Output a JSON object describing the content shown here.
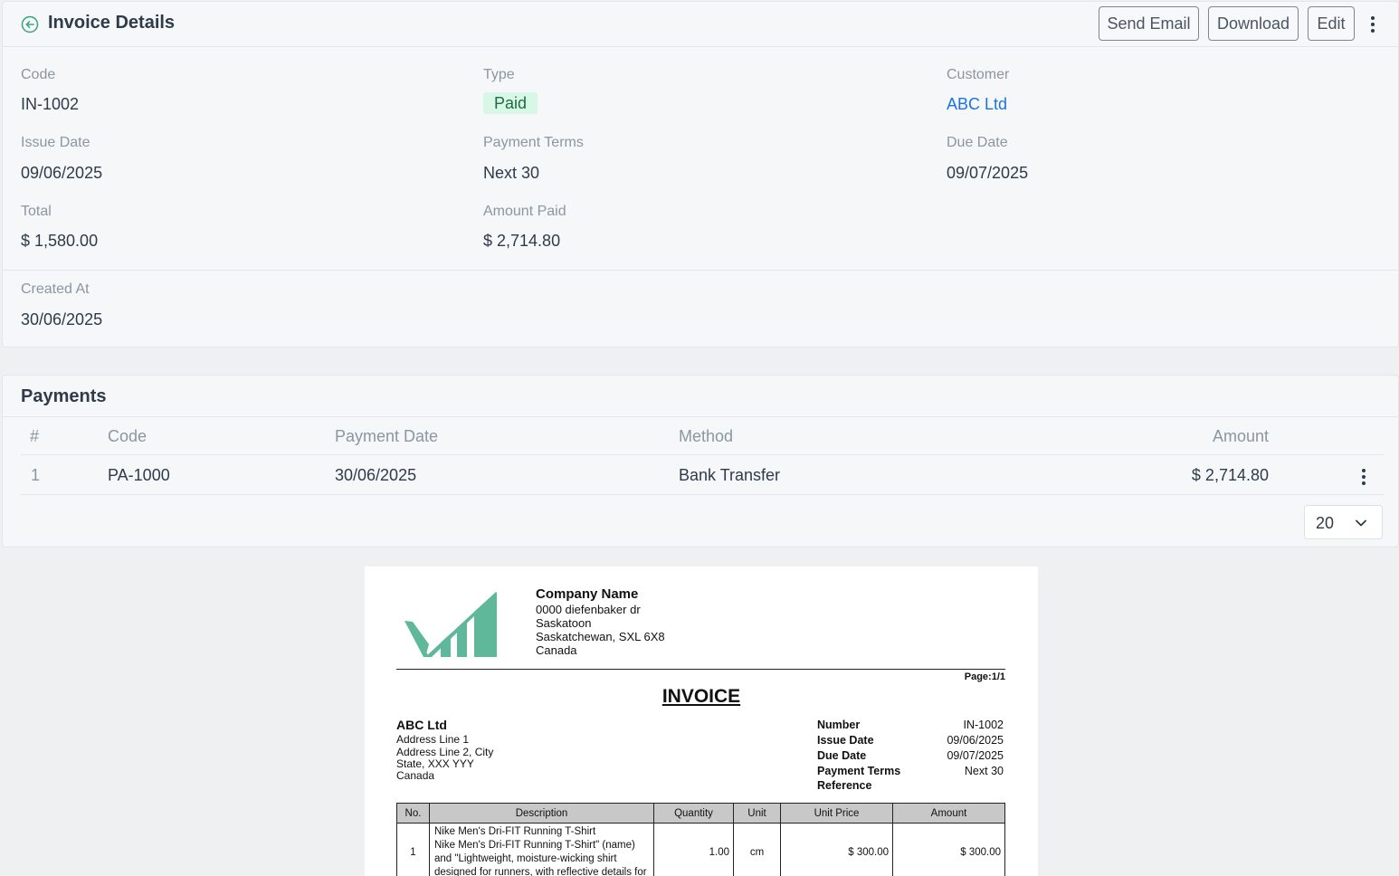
{
  "header": {
    "title": "Invoice Details",
    "buttons": {
      "send_email": "Send Email",
      "download": "Download",
      "edit": "Edit"
    }
  },
  "details": {
    "code_label": "Code",
    "code": "IN-1002",
    "type_label": "Type",
    "type": "Paid",
    "customer_label": "Customer",
    "customer": "ABC Ltd",
    "issue_date_label": "Issue Date",
    "issue_date": "09/06/2025",
    "payment_terms_label": "Payment Terms",
    "payment_terms": "Next 30",
    "due_date_label": "Due Date",
    "due_date": "09/07/2025",
    "total_label": "Total",
    "total": "$ 1,580.00",
    "amount_paid_label": "Amount Paid",
    "amount_paid": "$ 2,714.80",
    "created_at_label": "Created At",
    "created_at": "30/06/2025"
  },
  "payments": {
    "title": "Payments",
    "columns": {
      "index": "#",
      "code": "Code",
      "payment_date": "Payment Date",
      "method": "Method",
      "amount": "Amount"
    },
    "rows": [
      {
        "index": "1",
        "code": "PA-1000",
        "payment_date": "30/06/2025",
        "method": "Bank Transfer",
        "amount": "$ 2,714.80"
      }
    ],
    "page_size": "20"
  },
  "invoice_preview": {
    "company_name": "Company Name",
    "company_address": [
      "0000 diefenbaker dr",
      "Saskatoon",
      "Saskatchewan, SXL 6X8",
      "Canada"
    ],
    "page": "Page:1/1",
    "heading": "INVOICE",
    "customer_name": "ABC Ltd",
    "customer_address": [
      "Address Line 1",
      "Address Line 2, City",
      "State, XXX YYY",
      "Canada"
    ],
    "meta": {
      "number_label": "Number",
      "number": "IN-1002",
      "issue_date_label": "Issue Date",
      "issue_date": "09/06/2025",
      "due_date_label": "Due Date",
      "due_date": "09/07/2025",
      "payment_terms_label": "Payment Terms",
      "payment_terms": "Next 30",
      "reference_label": "Reference"
    },
    "table": {
      "columns": {
        "no": "No.",
        "description": "Description",
        "quantity": "Quantity",
        "unit": "Unit",
        "unit_price": "Unit Price",
        "amount": "Amount"
      },
      "rows": [
        {
          "no": "1",
          "description": [
            "Nike Men's Dri-FIT Running T-Shirt",
            "Nike Men's Dri-FIT Running T-Shirt\" (name)",
            "and \"Lightweight, moisture-wicking shirt",
            "designed for runners, with reflective details for"
          ],
          "quantity": "1.00",
          "unit": "cm",
          "unit_price": "$ 300.00",
          "amount": "$ 300.00"
        }
      ]
    }
  },
  "colors": {
    "accent": "#1a73e8",
    "paid_badge_bg": "#d9f7e6",
    "logo": "#5fb89a"
  }
}
